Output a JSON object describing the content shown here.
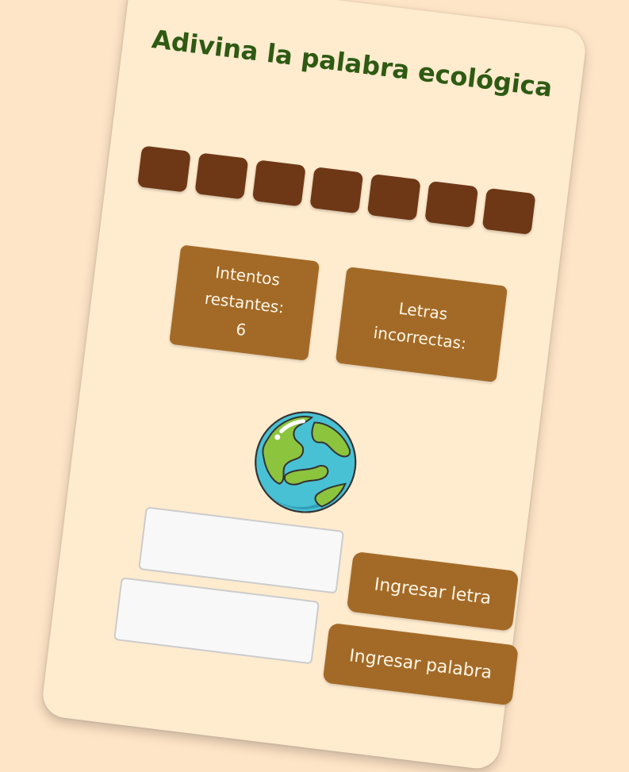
{
  "game": {
    "title": "Adivina la palabra ecológica",
    "tiles": [
      "",
      "",
      "",
      "",
      "",
      "",
      ""
    ],
    "attempts": {
      "label_line1": "Intentos",
      "label_line2": "restantes:",
      "value": "6"
    },
    "wrong_letters": {
      "label_line1": "Letras",
      "label_line2": "incorrectas:",
      "value": ""
    },
    "image_icon": "earth-globe-icon",
    "letter_input": {
      "value": "",
      "placeholder": ""
    },
    "word_input": {
      "value": "",
      "placeholder": ""
    },
    "buttons": {
      "letter": "Ingresar letra",
      "word": "Ingresar palabra"
    }
  },
  "colors": {
    "background": "#ffe5c7",
    "card": "#ffebce",
    "title": "#2e5a13",
    "tile": "#6e3816",
    "panel": "#a36a27"
  }
}
